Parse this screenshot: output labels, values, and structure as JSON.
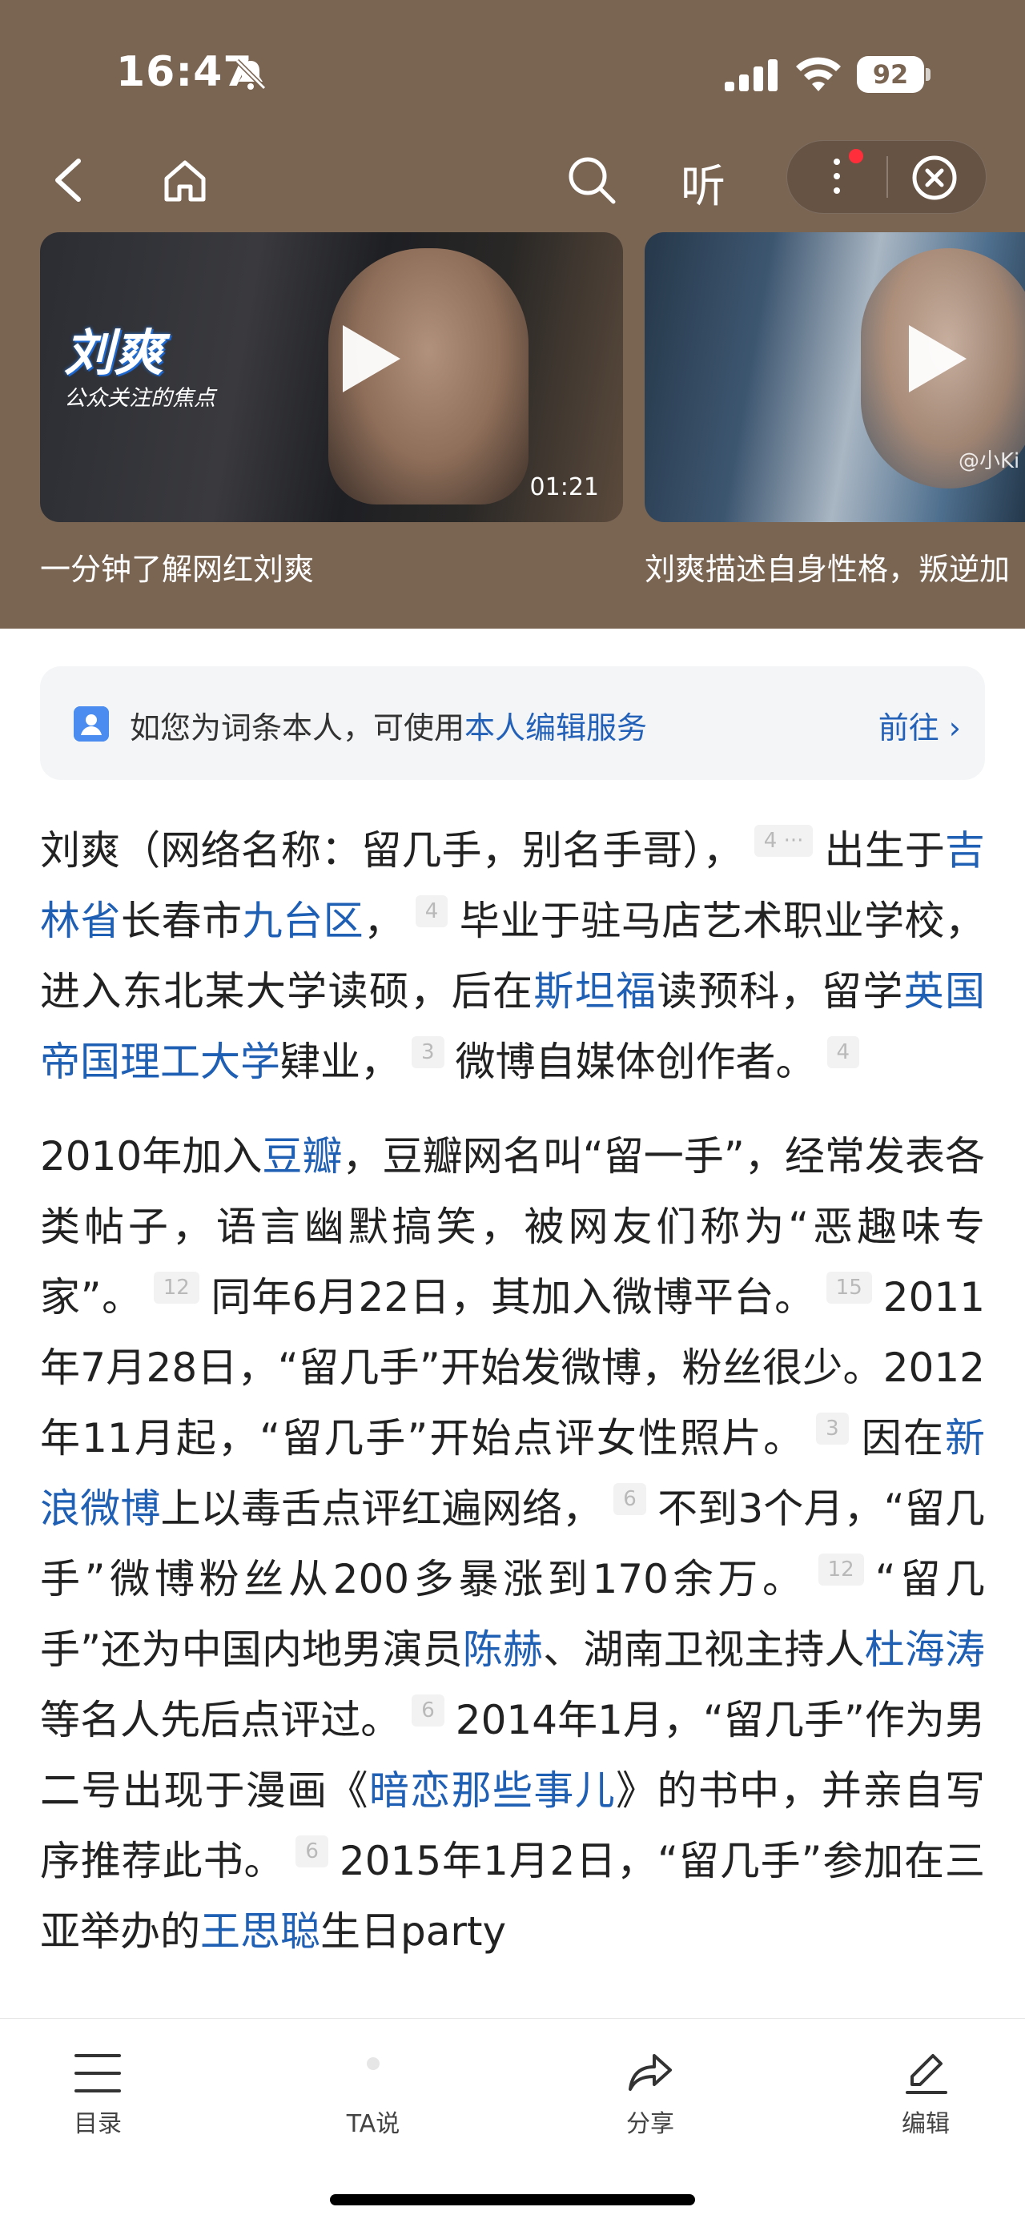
{
  "status": {
    "time": "16:47",
    "battery": "92"
  },
  "nav": {
    "listen_label": "听"
  },
  "videos": [
    {
      "overlay_title": "刘爽",
      "overlay_subtitle": "公众关注的焦点",
      "duration": "01:21",
      "caption": "一分钟了解网红刘爽"
    },
    {
      "watermark": "@小Ki",
      "caption": "刘爽描述自身性格，叛逆加"
    }
  ],
  "notice": {
    "prefix": "如您为词条本人，可使用",
    "link": "本人编辑服务",
    "action": "前往 ›"
  },
  "article": {
    "p1": {
      "t1": "刘爽（网络名称：留几手，别名手哥），",
      "r1": "4 ···",
      "t2": "出生于",
      "l1": "吉林省",
      "t3": "长春市",
      "l2": "九台区",
      "t4": "，",
      "r2": "4",
      "t5": "毕业于驻马店艺术职业学校，进入东北某大学读硕，后在",
      "l3": "斯坦福",
      "t6": "读预科，留学",
      "l4": "英国帝国理工大学",
      "t7": "肄业，",
      "r3": "3",
      "t8": "微博自媒体创作者。",
      "r4": "4"
    },
    "p2": {
      "t1": "2010年加入",
      "l1": "豆瓣",
      "t2": "，豆瓣网名叫“留一手”，经常发表各类帖子，语言幽默搞笑，被网友们称为“恶趣味专家”。",
      "r1": "12",
      "t3": "同年6月22日，其加入微博平台。",
      "r2": "15",
      "t4": "2011年7月28日，“留几手”开始发微博，粉丝很少。2012年11月起，“留几手”开始点评女性照片。",
      "r3": "3",
      "t5": "因在",
      "l2": "新浪微博",
      "t6": "上以毒舌点评红遍网络，",
      "r4": "6",
      "t7": "不到3个月，“留几手”微博粉丝从200多暴涨到170余万。",
      "r5": "12",
      "t8": "“留几手”还为中国内地男演员",
      "l3": "陈赫",
      "t9": "、湖南卫视主持人",
      "l4": "杜海涛",
      "t10": "等名人先后点评过。",
      "r6": "6",
      "t11": "2014年1月，“留几手”作为男二号出现于漫画《",
      "l5": "暗恋那些事儿",
      "t12": "》的书中，并亲自写序推荐此书。",
      "r7": "6",
      "t13": "2015年1月2日，“留几手”参加在三亚举办的",
      "l6": "王思聪",
      "t14": "生日party"
    }
  },
  "tabbar": {
    "toc": "目录",
    "ta": "TA说",
    "share": "分享",
    "edit": "编辑"
  },
  "colors": {
    "header_bg": "#7a6452",
    "link": "#1f5fb4",
    "accent": "#4a8cf0"
  }
}
